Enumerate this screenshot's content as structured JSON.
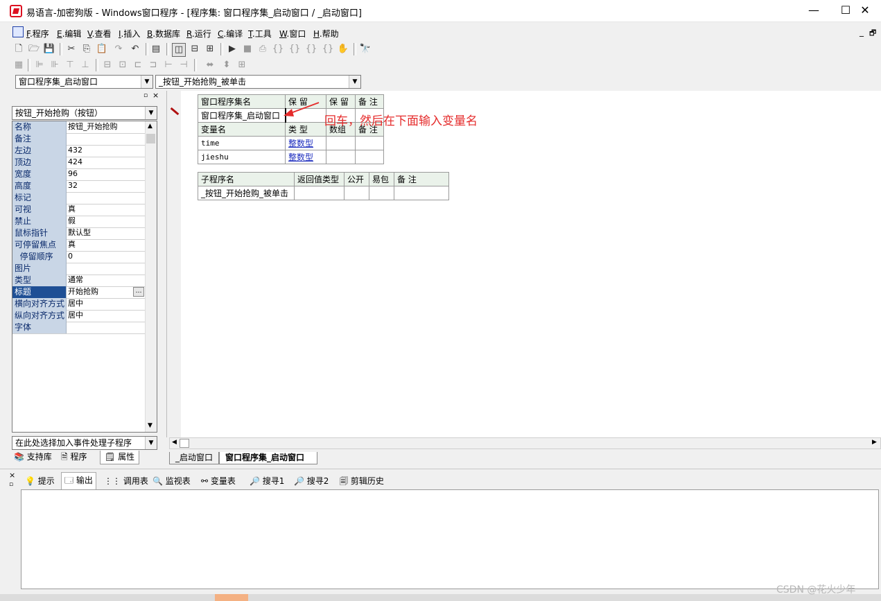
{
  "window": {
    "title": "易语言-加密狗版 - Windows窗口程序 - [程序集: 窗口程序集_启动窗口 / _启动窗口]",
    "minimize": "—",
    "maximize": "☐",
    "close": "✕"
  },
  "menu": [
    {
      "key": "F",
      "label": ".程序"
    },
    {
      "key": "E",
      "label": ".编辑"
    },
    {
      "key": "V",
      "label": ".查看"
    },
    {
      "key": "I",
      "label": ".插入"
    },
    {
      "key": "B",
      "label": ".数据库"
    },
    {
      "key": "R",
      "label": ".运行"
    },
    {
      "key": "C",
      "label": ".编译"
    },
    {
      "key": "T",
      "label": ".工具"
    },
    {
      "key": "W",
      "label": ".窗口"
    },
    {
      "key": "H",
      "label": ".帮助"
    }
  ],
  "mdi_controls": {
    "min": "_",
    "restore": "🗗"
  },
  "combos": {
    "assembly": "窗口程序集_启动窗口",
    "subroutine": "_按钮_开始抢购_被单击"
  },
  "left_panel": {
    "object_combo": "按钮_开始抢购（按钮）",
    "event_combo": "在此处选择加入事件处理子程序",
    "properties": [
      {
        "name": "名称",
        "value": "按钮_开始抢购"
      },
      {
        "name": "备注",
        "value": ""
      },
      {
        "name": "左边",
        "value": "432"
      },
      {
        "name": "顶边",
        "value": "424"
      },
      {
        "name": "宽度",
        "value": "96"
      },
      {
        "name": "高度",
        "value": "32"
      },
      {
        "name": "标记",
        "value": ""
      },
      {
        "name": "可视",
        "value": "真"
      },
      {
        "name": "禁止",
        "value": "假"
      },
      {
        "name": "鼠标指针",
        "value": "默认型"
      },
      {
        "name": "可停留焦点",
        "value": "真"
      },
      {
        "name": "  停留顺序",
        "value": "0"
      },
      {
        "name": "图片",
        "value": ""
      },
      {
        "name": "类型",
        "value": "通常"
      },
      {
        "name": "标题",
        "value": "开始抢购"
      },
      {
        "name": "横向对齐方式",
        "value": "居中"
      },
      {
        "name": "纵向对齐方式",
        "value": "居中"
      },
      {
        "name": "字体",
        "value": ""
      }
    ],
    "tabs": [
      "支持库",
      "程序",
      "属性"
    ]
  },
  "editor": {
    "assembly_table": {
      "headers": [
        "窗口程序集名",
        "保 留",
        "保 留",
        "备 注"
      ],
      "row": [
        "窗口程序集_启动窗口",
        "",
        "",
        ""
      ]
    },
    "var_table": {
      "headers": [
        "变量名",
        "类 型",
        "数组",
        "备 注"
      ],
      "rows": [
        [
          "time",
          "整数型",
          "",
          ""
        ],
        [
          "jieshu",
          "整数型",
          "",
          ""
        ]
      ]
    },
    "sub_table": {
      "headers": [
        "子程序名",
        "返回值类型",
        "公开",
        "易包",
        "备 注"
      ],
      "row": [
        "_按钮_开始抢购_被单击",
        "",
        "",
        "",
        ""
      ]
    },
    "annotation": "回车，然后在下面输入变量名",
    "tabs": [
      "_启动窗口",
      "窗口程序集_启动窗口"
    ]
  },
  "bottom_tabs": [
    "提示",
    "输出",
    "调用表",
    "监视表",
    "变量表",
    "搜寻1",
    "搜寻2",
    "剪辑历史"
  ],
  "watermark": "CSDN @花火少年",
  "colors": {
    "annotation": "#e52b2b",
    "property_name_bg": "#c9d6e6",
    "selected_bg": "#1e4f95"
  }
}
